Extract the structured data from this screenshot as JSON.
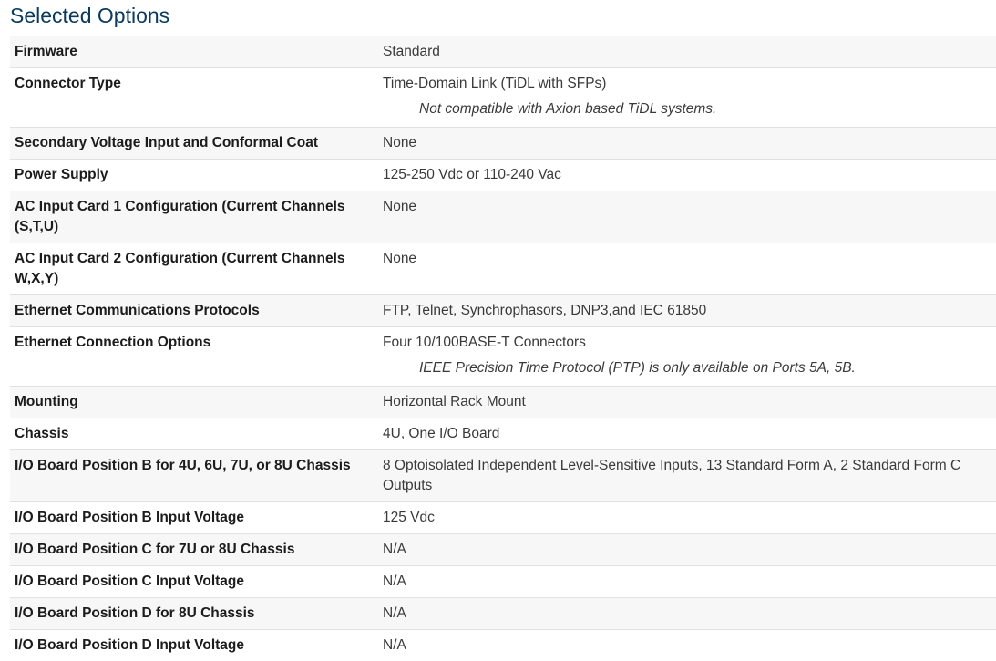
{
  "title": "Selected Options",
  "rows": [
    {
      "label": "Firmware",
      "value": "Standard",
      "note": ""
    },
    {
      "label": "Connector Type",
      "value": "Time-Domain Link (TiDL with SFPs)",
      "note": "Not compatible with Axion based TiDL systems."
    },
    {
      "label": "Secondary Voltage Input and Conformal Coat",
      "value": "None",
      "note": ""
    },
    {
      "label": "Power Supply",
      "value": "125-250 Vdc or 110-240 Vac",
      "note": ""
    },
    {
      "label": "AC Input Card 1 Configuration (Current Channels (S,T,U)",
      "value": "None",
      "note": ""
    },
    {
      "label": "AC Input Card 2 Configuration (Current Channels W,X,Y)",
      "value": "None",
      "note": ""
    },
    {
      "label": "Ethernet Communications Protocols",
      "value": "FTP, Telnet, Synchrophasors, DNP3,and IEC 61850",
      "note": ""
    },
    {
      "label": "Ethernet Connection Options",
      "value": "Four 10/100BASE-T Connectors",
      "note": "IEEE Precision Time Protocol (PTP) is only available on Ports 5A, 5B."
    },
    {
      "label": "Mounting",
      "value": "Horizontal Rack Mount",
      "note": ""
    },
    {
      "label": "Chassis",
      "value": "4U, One I/O Board",
      "note": ""
    },
    {
      "label": "I/O Board Position B for 4U, 6U, 7U, or 8U Chassis",
      "value": "8 Optoisolated Independent Level-Sensitive Inputs, 13 Standard Form A, 2 Standard Form C Outputs",
      "note": ""
    },
    {
      "label": "I/O Board Position B Input Voltage",
      "value": "125 Vdc",
      "note": ""
    },
    {
      "label": "I/O Board Position C for 7U or 8U Chassis",
      "value": "N/A",
      "note": ""
    },
    {
      "label": "I/O Board Position C Input Voltage",
      "value": "N/A",
      "note": ""
    },
    {
      "label": "I/O Board Position D for 8U Chassis",
      "value": "N/A",
      "note": ""
    },
    {
      "label": "I/O Board Position D Input Voltage",
      "value": "N/A",
      "note": ""
    }
  ]
}
